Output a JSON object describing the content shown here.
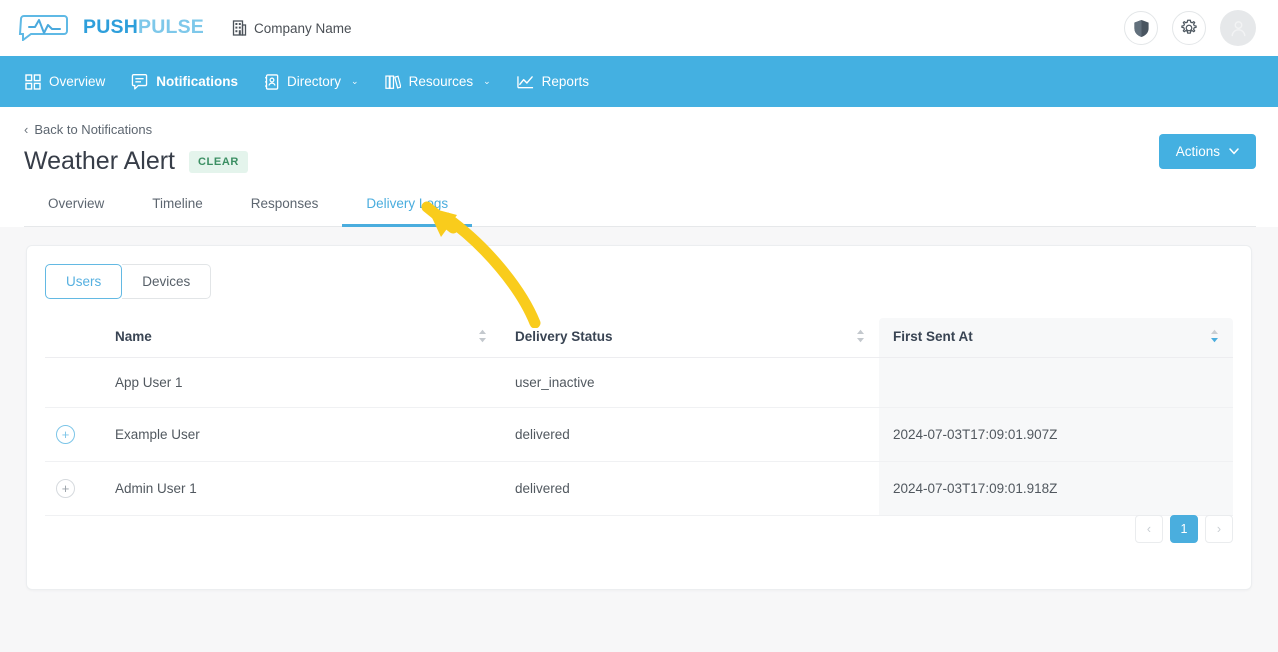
{
  "brand": {
    "logo_text_bold": "PUSH",
    "logo_text_light": "PULSE",
    "logo_icon": "pulse-bubble-icon"
  },
  "topbar": {
    "company_name": "Company Name",
    "company_icon": "building-icon",
    "shield_icon": "shield-icon",
    "settings_icon": "gear-icon",
    "avatar_icon": "user-avatar-icon",
    "accent_color": "#44b0e1"
  },
  "nav": {
    "items": [
      {
        "label": "Overview",
        "icon": "grid-icon",
        "caret": false,
        "active": false
      },
      {
        "label": "Notifications",
        "icon": "speech-bubble-icon",
        "caret": false,
        "active": true
      },
      {
        "label": "Directory",
        "icon": "contact-card-icon",
        "caret": true,
        "active": false
      },
      {
        "label": "Resources",
        "icon": "books-icon",
        "caret": true,
        "active": false
      },
      {
        "label": "Reports",
        "icon": "line-chart-icon",
        "caret": false,
        "active": false
      }
    ],
    "caret_glyph": "⌄"
  },
  "header": {
    "back_label": "Back to Notifications",
    "back_icon": "chevron-left-icon",
    "title": "Weather Alert",
    "status_badge": "CLEAR",
    "status_badge_color": "#3b8f63",
    "actions_label": "Actions",
    "actions_caret": "⌄"
  },
  "tabs": [
    {
      "label": "Overview",
      "active": false
    },
    {
      "label": "Timeline",
      "active": false
    },
    {
      "label": "Responses",
      "active": false
    },
    {
      "label": "Delivery Logs",
      "active": true
    }
  ],
  "card": {
    "segments": [
      {
        "label": "Users",
        "active": true
      },
      {
        "label": "Devices",
        "active": false
      }
    ],
    "table": {
      "columns": [
        {
          "label": "Name",
          "sortable": true,
          "sorted": false
        },
        {
          "label": "Delivery Status",
          "sortable": true,
          "sorted": false
        },
        {
          "label": "First Sent At",
          "sortable": true,
          "sorted": true
        }
      ],
      "rows": [
        {
          "expandable": false,
          "expand_state": "none",
          "name": "App User 1",
          "status": "user_inactive",
          "first_sent_at": ""
        },
        {
          "expandable": true,
          "expand_state": "highlighted",
          "name": "Example User",
          "status": "delivered",
          "first_sent_at": "2024-07-03T17:09:01.907Z"
        },
        {
          "expandable": true,
          "expand_state": "normal",
          "name": "Admin User 1",
          "status": "delivered",
          "first_sent_at": "2024-07-03T17:09:01.918Z"
        }
      ],
      "expand_glyph": "+"
    },
    "pagination": {
      "prev_glyph": "‹",
      "next_glyph": "›",
      "pages": [
        "1"
      ],
      "current_page": "1"
    }
  },
  "annotation": {
    "type": "curved-arrow",
    "color": "#f9cc1c",
    "points_to": "Delivery Logs"
  }
}
